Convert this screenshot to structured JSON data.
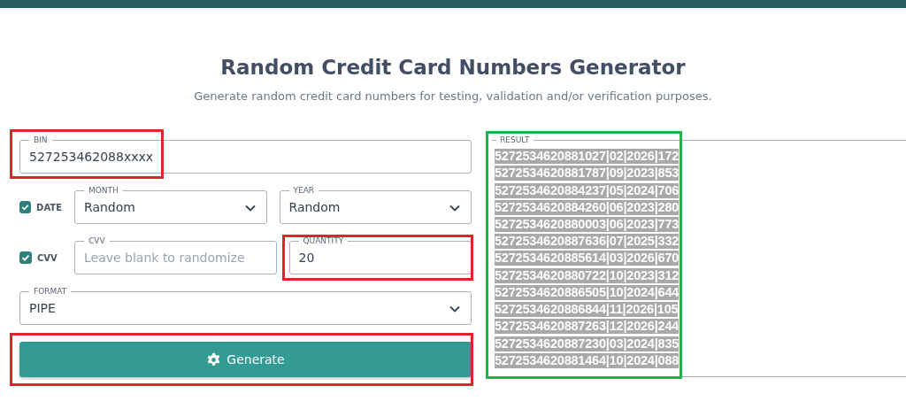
{
  "title": "Random Credit Card Numbers Generator",
  "subtitle": "Generate random credit card numbers for testing, validation and/or verification purposes.",
  "bin": {
    "label": "BIN",
    "value": "527253462088xxxx",
    "highlighted": true
  },
  "date": {
    "label": "DATE",
    "checked": true
  },
  "month": {
    "label": "MONTH",
    "value": "Random"
  },
  "year": {
    "label": "YEAR",
    "value": "Random"
  },
  "cvv_toggle": {
    "label": "CVV",
    "checked": true
  },
  "cvv": {
    "label": "CVV",
    "placeholder": "Leave blank to randomize"
  },
  "quantity": {
    "label": "QUANTITY",
    "value": "20",
    "highlighted": true
  },
  "format": {
    "label": "FORMAT",
    "value": "PIPE"
  },
  "generate": {
    "label": "Generate",
    "highlighted": true
  },
  "result": {
    "label": "RESULT",
    "highlighted": true,
    "lines": [
      "5272534620881027|02|2026|172",
      "5272534620881787|09|2023|853",
      "5272534620884237|05|2024|706",
      "5272534620884260|06|2023|280",
      "5272534620880003|06|2023|773",
      "5272534620887636|07|2025|332",
      "5272534620885614|03|2026|670",
      "5272534620880722|10|2023|312",
      "5272534620886505|10|2024|644",
      "5272534620886844|11|2026|105",
      "5272534620887263|12|2026|244",
      "5272534620887230|03|2024|835",
      "5272534620881464|10|2024|088"
    ]
  }
}
